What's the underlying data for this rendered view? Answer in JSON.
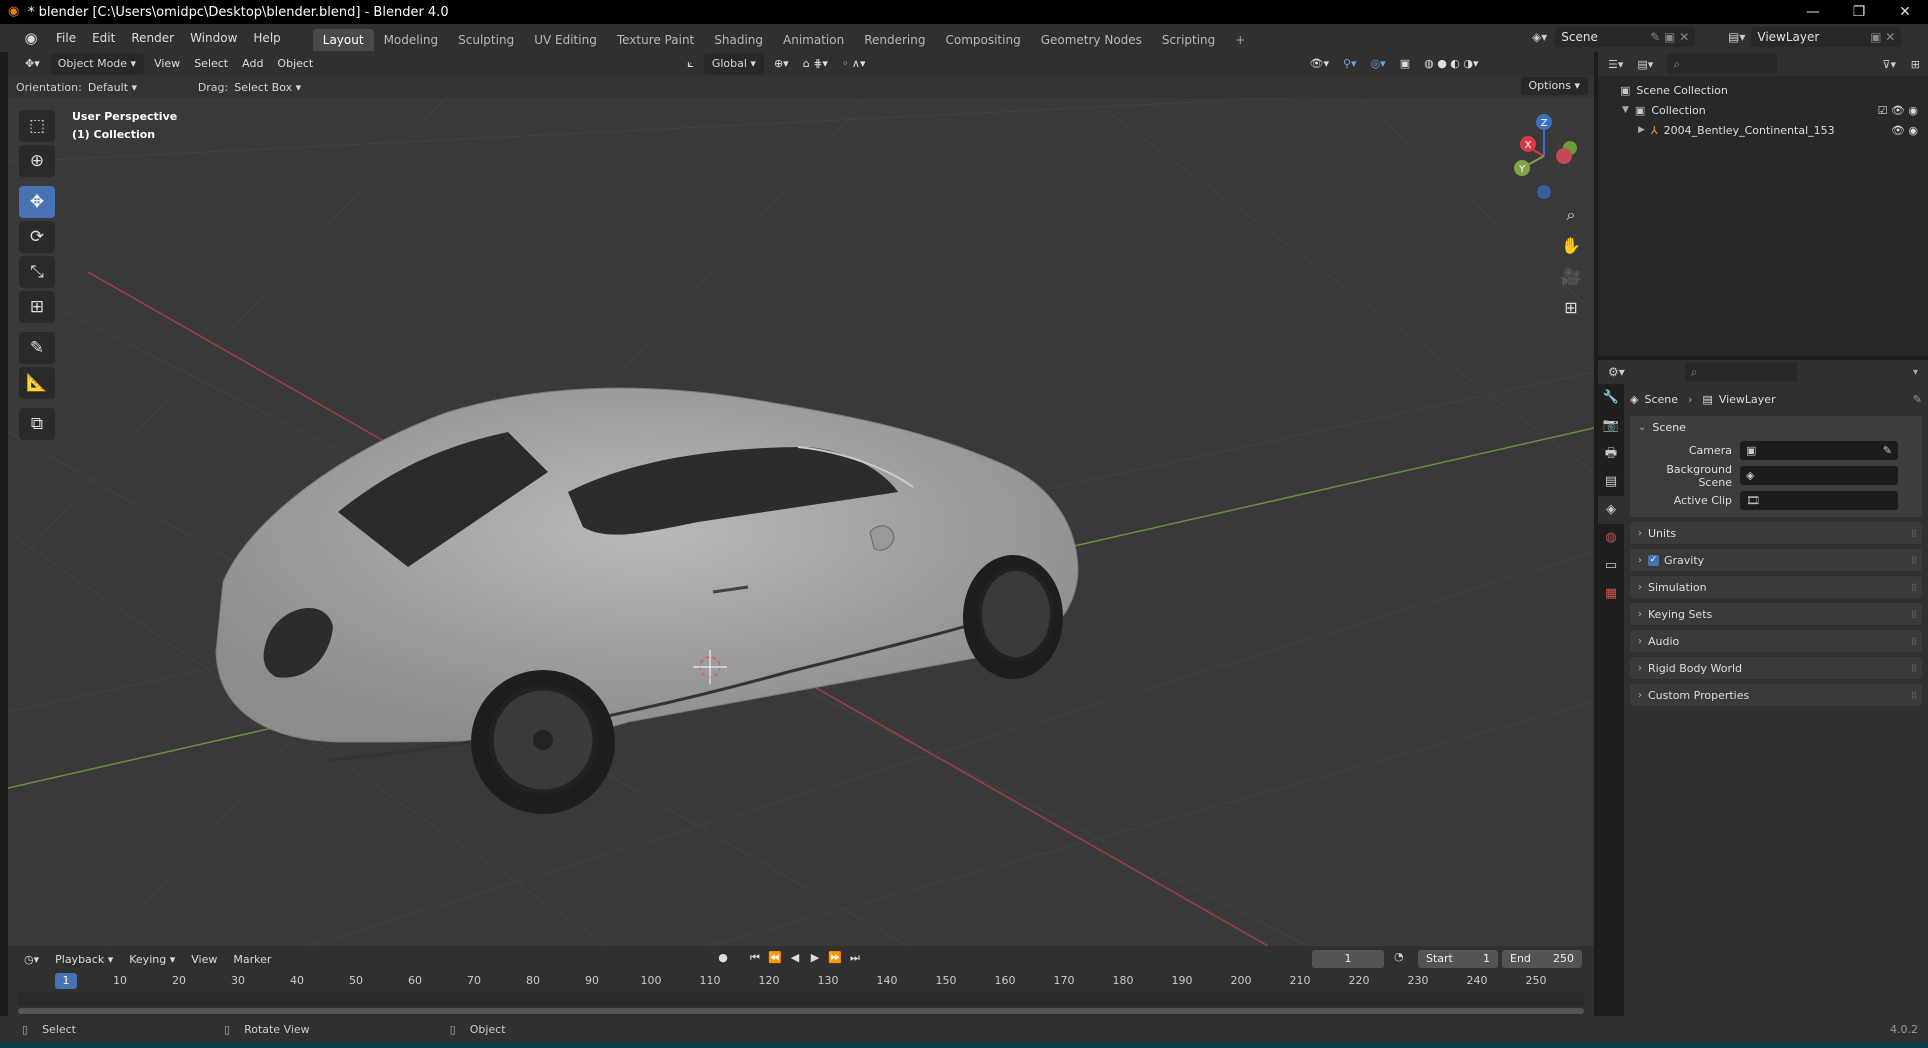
{
  "window": {
    "title": "* blender [C:\\Users\\omidpc\\Desktop\\blender.blend] - Blender 4.0",
    "controls": [
      "minimize-icon",
      "restore-icon",
      "close-icon"
    ]
  },
  "menu": {
    "items": [
      "File",
      "Edit",
      "Render",
      "Window",
      "Help"
    ]
  },
  "workspaces": {
    "tabs": [
      "Layout",
      "Modeling",
      "Sculpting",
      "UV Editing",
      "Texture Paint",
      "Shading",
      "Animation",
      "Rendering",
      "Compositing",
      "Geometry Nodes",
      "Scripting"
    ],
    "active": "Layout",
    "add": "+"
  },
  "scene_selector": {
    "value": "Scene"
  },
  "viewlayer_selector": {
    "value": "ViewLayer"
  },
  "viewport": {
    "mode": "Object Mode",
    "menus": [
      "View",
      "Select",
      "Add",
      "Object"
    ],
    "transform_orientation": "Global",
    "orientation_label": "Orientation:",
    "orientation_value": "Default",
    "drag_label": "Drag:",
    "drag_value": "Select Box",
    "options": "Options",
    "overlay_line1": "User Perspective",
    "overlay_line2": "(1) Collection",
    "gizmo_axes": {
      "z": "Z",
      "x": "X",
      "y": "Y"
    },
    "colors": {
      "x_axis": "#d83a47",
      "y_axis": "#7ea34a",
      "z_axis": "#3b70c2",
      "tool_active": "#4772b3",
      "background": "#393939"
    }
  },
  "toolbar": {
    "tools": [
      "select-box-icon",
      "cursor-icon",
      "move-icon",
      "rotate-icon",
      "scale-icon",
      "transform-icon",
      "annotate-icon",
      "measure-icon",
      "add-cube-icon"
    ],
    "active": "move-icon"
  },
  "timeline": {
    "menus": [
      "Playback",
      "Keying",
      "View",
      "Marker"
    ],
    "current_frame": "1",
    "start_label": "Start",
    "start": "1",
    "end_label": "End",
    "end": "250",
    "ticks": [
      "10",
      "20",
      "30",
      "40",
      "50",
      "60",
      "70",
      "80",
      "90",
      "100",
      "110",
      "120",
      "130",
      "140",
      "150",
      "160",
      "170",
      "180",
      "190",
      "200",
      "210",
      "220",
      "230",
      "240",
      "250"
    ],
    "playhead": "1"
  },
  "statusbar": {
    "select": "Select",
    "rotate": "Rotate View",
    "object": "Object",
    "version": "4.0.2"
  },
  "outliner": {
    "scene_collection": "Scene Collection",
    "collection": "Collection",
    "object": "2004_Bentley_Continental_153"
  },
  "properties": {
    "breadcrumb_scene": "Scene",
    "breadcrumb_viewlayer": "ViewLayer",
    "scene_panel": "Scene",
    "camera_label": "Camera",
    "background_scene_label": "Background Scene",
    "active_clip_label": "Active Clip",
    "subpanels": [
      "Units",
      "Gravity",
      "Simulation",
      "Keying Sets",
      "Audio",
      "Rigid Body World",
      "Custom Properties"
    ]
  }
}
